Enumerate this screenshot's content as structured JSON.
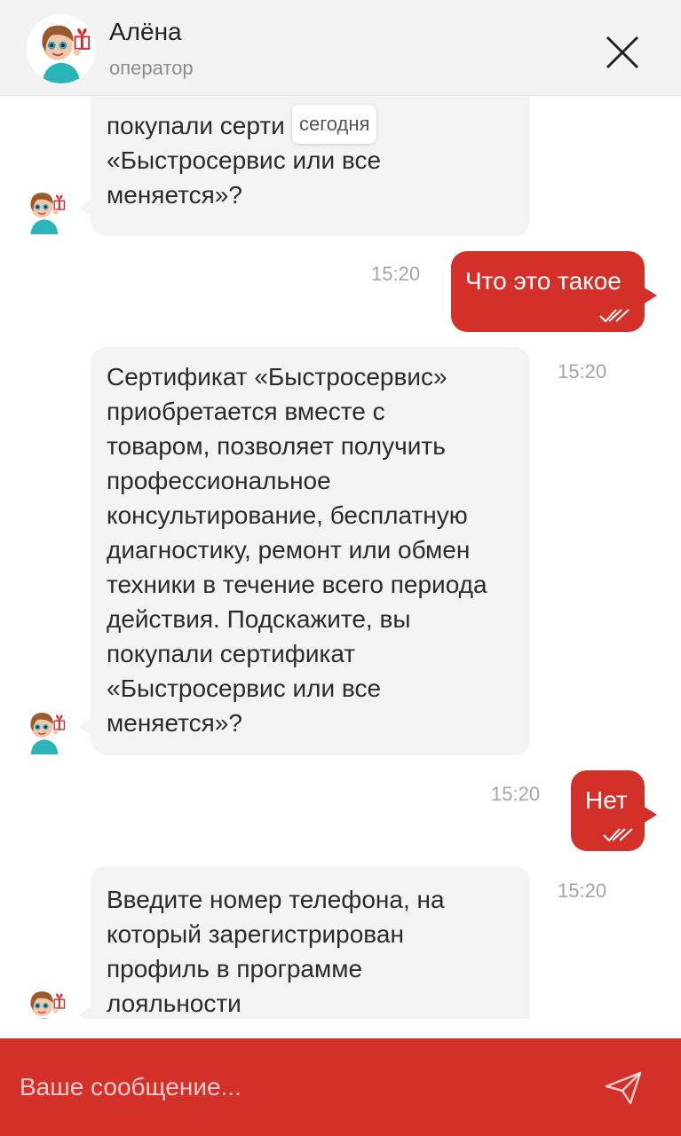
{
  "header": {
    "operator_name": "Алёна",
    "operator_role": "оператор",
    "close_icon": "close-icon"
  },
  "date_separator": "сегодня",
  "messages": [
    {
      "direction": "incoming",
      "lines": [
        "покупали серти",
        "«Быстросервис или все",
        "меняется»?"
      ],
      "time": ""
    },
    {
      "direction": "outgoing",
      "text": "Что это такое",
      "time": "15:20",
      "status": "read"
    },
    {
      "direction": "incoming",
      "lines": [
        "Сертификат «Быстросервис»",
        "приобретается вместе с",
        "товаром, позволяет получить",
        "профессиональное",
        "консультирование, бесплатную",
        "диагностику, ремонт или обмен",
        "техники в течение всего периода",
        "действия. Подскажите, вы",
        "покупали сертификат",
        "«Быстросервис или все",
        "меняется»?"
      ],
      "time": "15:20"
    },
    {
      "direction": "outgoing",
      "text": "Нет",
      "time": "15:20",
      "status": "read"
    },
    {
      "direction": "incoming",
      "lines": [
        "Введите номер телефона, на",
        "который зарегистрирован",
        "профиль в программе",
        "лояльности"
      ],
      "time": "15:20"
    }
  ],
  "composer": {
    "placeholder": "Ваше сообщение...",
    "send_icon": "send-icon"
  },
  "colors": {
    "accent": "#d3302a",
    "incoming_bubble": "#f3f3f3",
    "header_bg": "#f2f2f2",
    "time_text": "#a5a5a5"
  }
}
